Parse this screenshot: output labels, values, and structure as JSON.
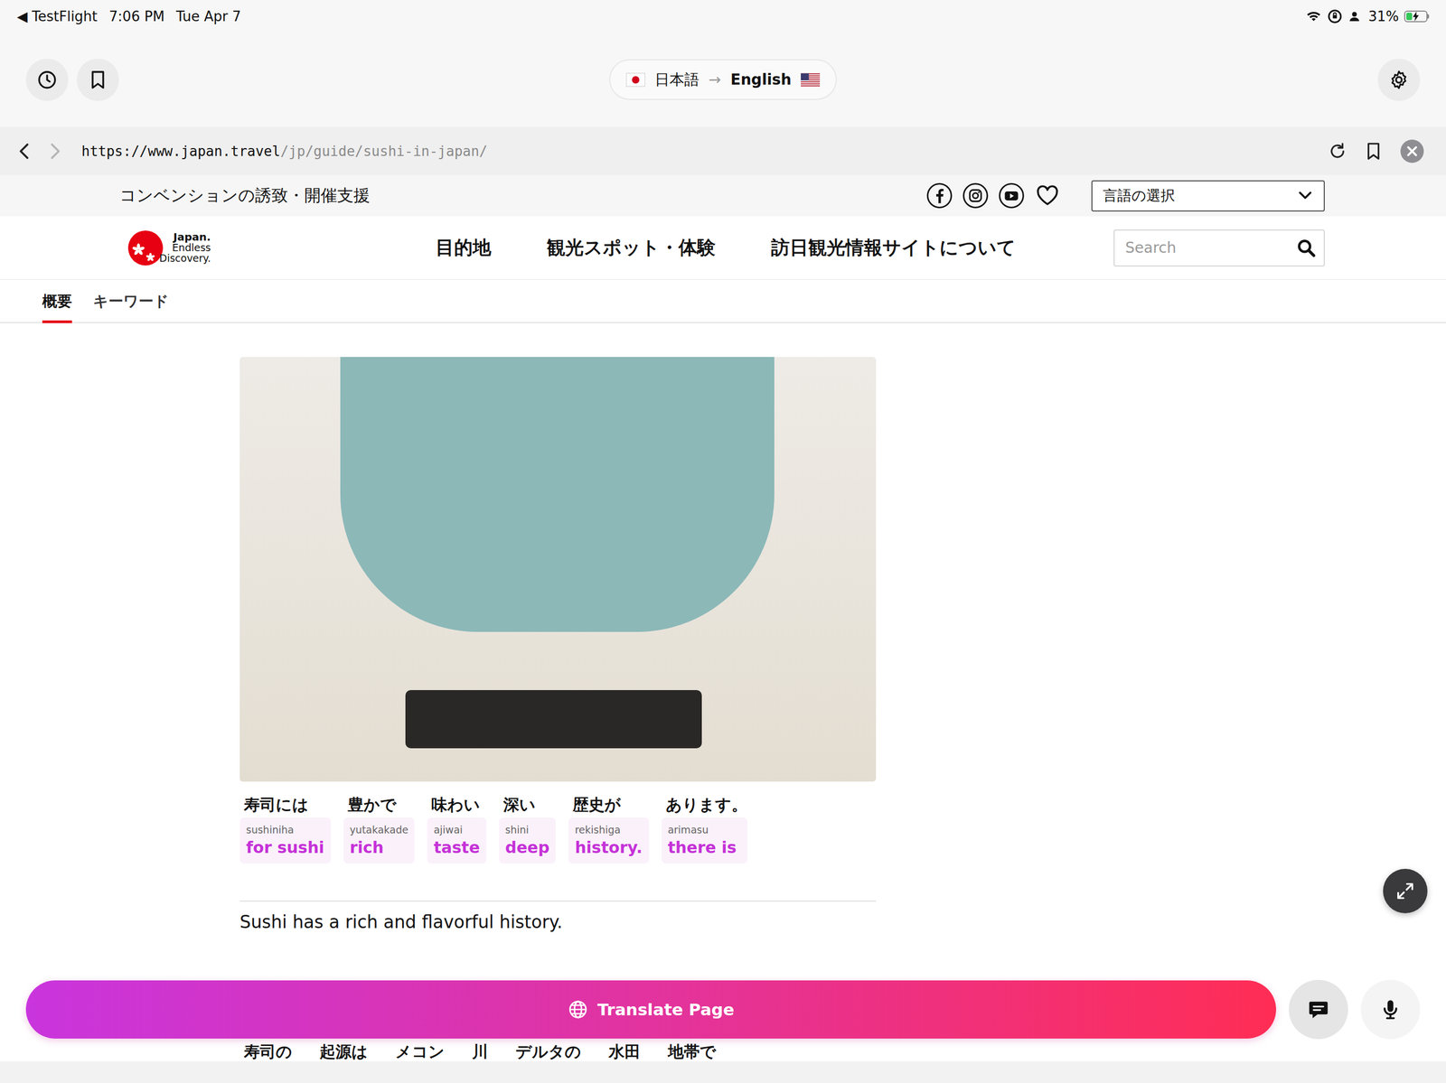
{
  "status_bar": {
    "back_app": "◀ TestFlight",
    "time": "7:06 PM",
    "date": "Tue Apr 7",
    "battery": "31%",
    "battery_level": 0.31,
    "charging": true
  },
  "toolbar": {
    "source_language": "日本語",
    "arrow": "→",
    "target_language": "English"
  },
  "address_bar": {
    "domain": "https://www.japan.travel",
    "path": "/jp/guide/sushi-in-japan/"
  },
  "site": {
    "top_link": "コンベンションの誘致・開催支援",
    "language_select": "言語の選択",
    "logo": {
      "line1": "Japan.",
      "line2": "Endless",
      "line3": "Discovery."
    },
    "nav": [
      "目的地",
      "観光スポット・体験",
      "訪日観光情報サイトについて"
    ],
    "search_placeholder": "Search",
    "tabs": [
      {
        "label": "概要",
        "selected": true
      },
      {
        "label": "キーワード",
        "selected": false
      }
    ]
  },
  "sentences": [
    {
      "tokens": [
        {
          "ja": "寿司には",
          "romaji": "sushiniha",
          "en": "for sushi"
        },
        {
          "ja": "豊かで",
          "romaji": "yutakakade",
          "en": "rich"
        },
        {
          "ja": "味わい",
          "romaji": "ajiwai",
          "en": "taste"
        },
        {
          "ja": "深い",
          "romaji": "shini",
          "en": "deep"
        },
        {
          "ja": "歴史が",
          "romaji": "rekishiga",
          "en": "history."
        },
        {
          "ja": "あります。",
          "romaji": "arimasu",
          "en": "there is"
        }
      ],
      "translation": "Sushi has a rich and flavorful history."
    }
  ],
  "next_sentence_tokens": [
    "寿司の",
    "起源は",
    "メコン",
    "川",
    "デルタの",
    "水田",
    "地帯で"
  ],
  "bottom_bar": {
    "translate_button": "Translate Page"
  }
}
